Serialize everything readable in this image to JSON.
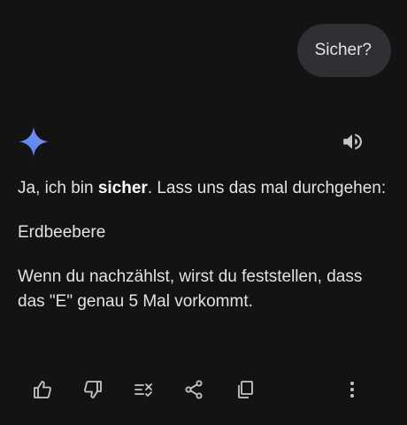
{
  "user_message": {
    "text": "Sicher?"
  },
  "response": {
    "para1_prefix": "Ja, ich bin ",
    "para1_bold": "sicher",
    "para1_suffix": ". Lass uns das mal durchgehen:",
    "word": "Erdbeebere",
    "para2": "Wenn du nachzählst, wirst du feststellen, dass das \"E\" genau 5 Mal vorkommt."
  },
  "icons": {
    "assistant": "gemini-sparkle-icon",
    "speaker": "speaker-icon",
    "actions": [
      "thumbs-up-icon",
      "thumbs-down-icon",
      "modify-response-icon",
      "share-icon",
      "copy-icon",
      "more-vert-icon"
    ]
  },
  "colors": {
    "background": "#131314",
    "bubble": "#2f3033",
    "text": "#e3e3e3",
    "icon": "#c4c7c5",
    "sparkle_start": "#4a90f5",
    "sparkle_end": "#9b72cb"
  }
}
